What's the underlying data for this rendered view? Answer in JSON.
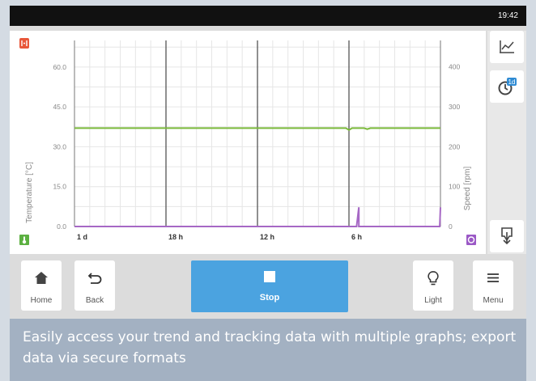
{
  "status": {
    "time": "19:42"
  },
  "chart_data": {
    "type": "line",
    "x_ticks": [
      "1 d",
      "18 h",
      "12 h",
      "6 h"
    ],
    "y_left": {
      "label": "Temperature [°C]",
      "ticks": [
        "60.0",
        "45.0",
        "30.0",
        "15.0",
        "0.0"
      ],
      "range": [
        0,
        70
      ]
    },
    "y_right": {
      "label": "Speed [rpm]",
      "ticks": [
        "400",
        "300",
        "200",
        "100",
        "0"
      ],
      "range": [
        0,
        466
      ]
    },
    "x_range_hours_ago": [
      24,
      0
    ],
    "grid": true,
    "series": [
      {
        "color": "#7cba3c",
        "axis": "left",
        "points": [
          [
            24,
            37
          ],
          [
            6.2,
            37
          ],
          [
            6.0,
            36.3
          ],
          [
            5.8,
            37
          ],
          [
            5.0,
            37
          ],
          [
            4.8,
            36.6
          ],
          [
            4.6,
            37
          ],
          [
            0,
            37
          ]
        ]
      },
      {
        "color": "#a668c5",
        "axis": "right",
        "points": [
          [
            24,
            0
          ],
          [
            5.5,
            0
          ],
          [
            5.35,
            48
          ],
          [
            5.35,
            0
          ],
          [
            0.05,
            0
          ],
          [
            0,
            48
          ]
        ]
      }
    ]
  },
  "sidebar": {
    "trend_icon": "trend-graph-icon",
    "timerange_badge": "1d",
    "export_icon": "export-download-icon"
  },
  "nav": {
    "home_label": "Home",
    "back_label": "Back",
    "stop_label": "Stop",
    "light_label": "Light",
    "menu_label": "Menu"
  },
  "caption": {
    "text": "Easily access your trend and tracking data with multiple graphs; export data via secure formats"
  },
  "colors": {
    "accent": "#4ba3e0",
    "temperature": "#7cba3c",
    "speed": "#a668c5",
    "alarm": "#e8573a",
    "caption_bg": "#a3b1c2"
  }
}
